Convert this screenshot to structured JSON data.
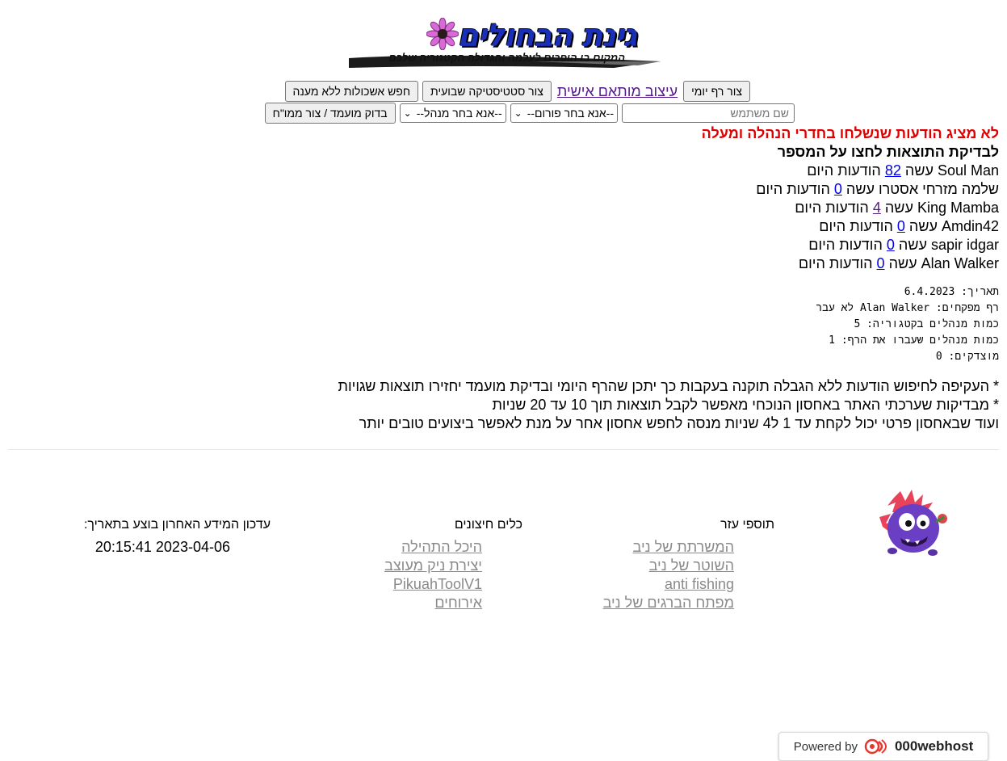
{
  "logo": {
    "title": "גינת הבחולים",
    "subtitle": "המקום בו הופכים לעלמה והגדולה הקטגוריה שלכם"
  },
  "toolbar": {
    "daily_report_button": "צור רף יומי",
    "custom_design_link": "עיצוב מותאם אישית",
    "weekly_stats_button": "צור סטטיסטיקה שבועית",
    "unanswered_search_button": "חפש אשכולות ללא מענה",
    "username_placeholder": "שם משתמש",
    "forum_select": "--אנא בחר פורום--",
    "manager_select": "--אנא בחר מנהל--",
    "candidate_button": "בדוק מועמד / צור ממו\"ח"
  },
  "main": {
    "warning": "לא מציג הודעות שנשלחו בחדרי הנהלה ומעלה",
    "hint": "לבדיקת התוצאות לחצו על המספר",
    "users": [
      {
        "name": "Soul Man",
        "did": "עשה",
        "count": "82",
        "suffix": "הודעות היום",
        "visited": false
      },
      {
        "name": "שלמה מזרחי אסטרו",
        "did": "עשה",
        "count": "0",
        "suffix": "הודעות היום",
        "visited": false
      },
      {
        "name": "King Mamba",
        "did": "עשה",
        "count": "4",
        "suffix": "הודעות היום",
        "visited": true
      },
      {
        "name": "Amdin42",
        "did": "עשה",
        "count": "0",
        "suffix": "הודעות היום",
        "visited": false
      },
      {
        "name": "sapir idgar",
        "did": "עשה",
        "count": "0",
        "suffix": "הודעות היום",
        "visited": false
      },
      {
        "name": "Alan Walker",
        "did": "עשה",
        "count": "0",
        "suffix": "הודעות היום",
        "visited": false
      }
    ],
    "summary": [
      "תאריך: 6.4.2023",
      "רף מפקחים: Alan Walker לא עבר",
      "כמות מנהלים בקטגוריה: 5",
      "כמות מנהלים שעברו את הרף: 1",
      "מוצדקים: 0"
    ],
    "notes": [
      "* העקיפה לחיפוש הודעות ללא הגבלה תוקנה בעקבות כך יתכן שהרף היומי ובדיקת מועמד יחזירו תוצאות שגויות",
      "* מבדיקות שערכתי האתר באחסון הנוכחי מאפשר לקבל תוצאות תוך 10 עד 20 שניות",
      "ועוד שבאחסון פרטי יכול לקחת עד 1 ל4 שניות מנסה לחפש אחסון אחר על מנת לאפשר ביצועים טובים יותר"
    ]
  },
  "footer": {
    "helpers": {
      "title": "תוספי עזר",
      "links": [
        "המשרתת של ניב",
        "השוטר של ניב",
        "anti fishing",
        "מפתח הברגים של ניב"
      ]
    },
    "external": {
      "title": "כלים חיצונים",
      "links": [
        "היכל התהילה",
        "יצירת ניק מעוצב",
        "PikuahToolV1",
        "אירוחים"
      ]
    },
    "update": {
      "title": "עדכון המידע האחרון בוצע בתאריך:",
      "time": "20:15:41 2023-04-06"
    },
    "powered_by": "Powered by",
    "host_brand": "000webhost"
  },
  "colors": {
    "warning": "#e00000",
    "link": "#0000ee",
    "visited": "#551a8b",
    "footer_link": "#8a8a8a"
  }
}
